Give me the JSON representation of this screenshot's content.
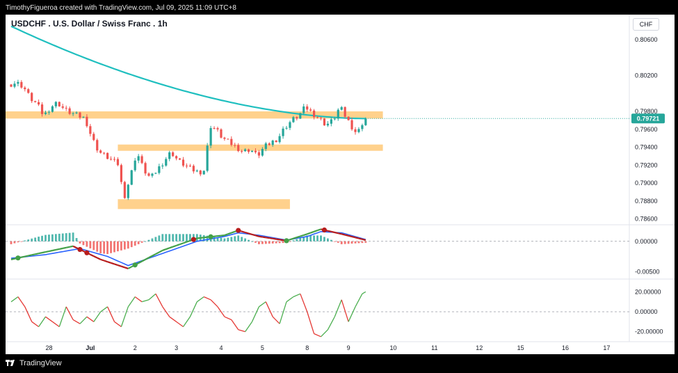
{
  "header": {
    "attribution": "TimothyFigueroa created with TradingView.com, Jul 09, 2025 11:09 UTC+8"
  },
  "footer": {
    "brand": "TradingView"
  },
  "chart": {
    "title": "USDCHF . U.S. Dollar / Swiss Franc . 1h",
    "currency": "CHF",
    "last_price_label": "0.79721"
  },
  "colors": {
    "up": "#26a69a",
    "down": "#ef5350",
    "ma": "#1fbfbf",
    "zone": "#ffcc80",
    "macd": "#2962ff",
    "signal_up": "#43a047",
    "signal_down": "#b71c1c",
    "osc_up": "#4caf50",
    "osc_down": "#e53935",
    "price_badge": "#26a69a"
  },
  "chart_data": [
    {
      "type": "candlestick",
      "pane": "price",
      "x_ticks": [
        "28",
        "Jul",
        "2",
        "3",
        "4",
        "5",
        "8",
        "9",
        "10",
        "11",
        "12",
        "15",
        "16",
        "17"
      ],
      "y_ticks": [
        "0.80600",
        "0.80200",
        "0.79800",
        "0.79600",
        "0.79400",
        "0.79200",
        "0.79000",
        "0.78800",
        "0.78600"
      ],
      "ylim": [
        0.7855,
        0.8088
      ],
      "last_price": 0.79721,
      "moving_average": {
        "start": 0.8075,
        "end": 0.7972
      },
      "zones": [
        {
          "low": 0.7972,
          "high": 0.798,
          "from": "start",
          "to": "9"
        },
        {
          "low": 0.7936,
          "high": 0.7943,
          "from": "1",
          "to": "9"
        },
        {
          "low": 0.7871,
          "high": 0.7882,
          "from": "1",
          "to": "5"
        }
      ],
      "price_points": [
        [
          0,
          0.801
        ],
        [
          2,
          0.8012
        ],
        [
          4,
          0.8008
        ],
        [
          6,
          0.7995
        ],
        [
          8,
          0.7988
        ],
        [
          10,
          0.7975
        ],
        [
          12,
          0.7985
        ],
        [
          14,
          0.799
        ],
        [
          16,
          0.7982
        ],
        [
          18,
          0.7978
        ],
        [
          20,
          0.7975
        ],
        [
          22,
          0.7972
        ],
        [
          24,
          0.795
        ],
        [
          26,
          0.7935
        ],
        [
          28,
          0.793
        ],
        [
          30,
          0.7925
        ],
        [
          32,
          0.792
        ],
        [
          33,
          0.788
        ],
        [
          35,
          0.7905
        ],
        [
          37,
          0.7935
        ],
        [
          39,
          0.7915
        ],
        [
          41,
          0.7905
        ],
        [
          43,
          0.7915
        ],
        [
          45,
          0.7925
        ],
        [
          47,
          0.7935
        ],
        [
          49,
          0.7925
        ],
        [
          51,
          0.792
        ],
        [
          53,
          0.7915
        ],
        [
          55,
          0.7912
        ],
        [
          57,
          0.7915
        ],
        [
          58,
          0.7965
        ],
        [
          60,
          0.796
        ],
        [
          62,
          0.795
        ],
        [
          64,
          0.7945
        ],
        [
          66,
          0.794
        ],
        [
          68,
          0.7935
        ],
        [
          70,
          0.7938
        ],
        [
          72,
          0.793
        ],
        [
          74,
          0.794
        ],
        [
          76,
          0.7945
        ],
        [
          78,
          0.795
        ],
        [
          80,
          0.7962
        ],
        [
          82,
          0.797
        ],
        [
          84,
          0.7975
        ],
        [
          86,
          0.7985
        ],
        [
          88,
          0.7978
        ],
        [
          90,
          0.7972
        ],
        [
          92,
          0.7965
        ],
        [
          94,
          0.797
        ],
        [
          96,
          0.7985
        ],
        [
          98,
          0.7972
        ],
        [
          100,
          0.796
        ],
        [
          101,
          0.7955
        ],
        [
          102,
          0.7962
        ],
        [
          103,
          0.7972
        ]
      ]
    },
    {
      "type": "line",
      "pane": "macd",
      "y_ticks": [
        "0.00000",
        "-0.00500"
      ],
      "ylim": [
        -0.006,
        0.0025
      ],
      "series": [
        {
          "values": [
            [
              0,
              -0.003
            ],
            [
              8,
              -0.002
            ],
            [
              18,
              -0.0008
            ],
            [
              26,
              -0.003
            ],
            [
              34,
              -0.0045
            ],
            [
              44,
              -0.0015
            ],
            [
              54,
              0.0005
            ],
            [
              62,
              0.001
            ],
            [
              66,
              0.0018
            ],
            [
              72,
              0.0008
            ],
            [
              80,
              0.0001
            ],
            [
              86,
              0.0012
            ],
            [
              90,
              0.002
            ],
            [
              96,
              0.0012
            ],
            [
              103,
              0.0002
            ]
          ]
        },
        {
          "values": [
            [
              0,
              -0.0028
            ],
            [
              10,
              -0.0022
            ],
            [
              20,
              -0.0012
            ],
            [
              28,
              -0.0025
            ],
            [
              34,
              -0.004
            ],
            [
              44,
              -0.002
            ],
            [
              54,
              0.0
            ],
            [
              62,
              0.0008
            ],
            [
              66,
              0.0014
            ],
            [
              72,
              0.001
            ],
            [
              80,
              0.0002
            ],
            [
              86,
              0.0008
            ],
            [
              90,
              0.0016
            ],
            [
              96,
              0.0014
            ],
            [
              103,
              0.0003
            ]
          ]
        }
      ],
      "crosses": [
        {
          "x": 2,
          "dir": "up"
        },
        {
          "x": 20,
          "dir": "down"
        },
        {
          "x": 22,
          "dir": "down"
        },
        {
          "x": 36,
          "dir": "up"
        },
        {
          "x": 53,
          "dir": "down"
        },
        {
          "x": 58,
          "dir": "up"
        },
        {
          "x": 66,
          "dir": "down"
        },
        {
          "x": 80,
          "dir": "up"
        },
        {
          "x": 91,
          "dir": "down"
        }
      ]
    },
    {
      "type": "line",
      "pane": "oscillator",
      "y_ticks": [
        "20.00000",
        "0.00000",
        "-20.00000"
      ],
      "ylim": [
        -30,
        30
      ],
      "values": [
        [
          0,
          10
        ],
        [
          2,
          15
        ],
        [
          4,
          5
        ],
        [
          6,
          -10
        ],
        [
          8,
          -15
        ],
        [
          10,
          -5
        ],
        [
          12,
          -10
        ],
        [
          14,
          -15
        ],
        [
          16,
          5
        ],
        [
          18,
          -8
        ],
        [
          20,
          -12
        ],
        [
          22,
          -5
        ],
        [
          24,
          -10
        ],
        [
          26,
          0
        ],
        [
          28,
          5
        ],
        [
          30,
          -10
        ],
        [
          32,
          -15
        ],
        [
          34,
          5
        ],
        [
          36,
          15
        ],
        [
          38,
          10
        ],
        [
          40,
          12
        ],
        [
          42,
          18
        ],
        [
          44,
          5
        ],
        [
          46,
          -5
        ],
        [
          48,
          -10
        ],
        [
          50,
          -15
        ],
        [
          52,
          -5
        ],
        [
          54,
          10
        ],
        [
          56,
          15
        ],
        [
          58,
          12
        ],
        [
          60,
          5
        ],
        [
          62,
          -5
        ],
        [
          64,
          -8
        ],
        [
          66,
          -18
        ],
        [
          68,
          -20
        ],
        [
          70,
          -10
        ],
        [
          72,
          5
        ],
        [
          74,
          10
        ],
        [
          76,
          -5
        ],
        [
          78,
          -12
        ],
        [
          80,
          10
        ],
        [
          82,
          15
        ],
        [
          84,
          18
        ],
        [
          86,
          0
        ],
        [
          88,
          -22
        ],
        [
          90,
          -25
        ],
        [
          92,
          -18
        ],
        [
          94,
          -5
        ],
        [
          96,
          12
        ],
        [
          98,
          -10
        ],
        [
          100,
          5
        ],
        [
          102,
          18
        ],
        [
          103,
          20
        ]
      ]
    }
  ]
}
